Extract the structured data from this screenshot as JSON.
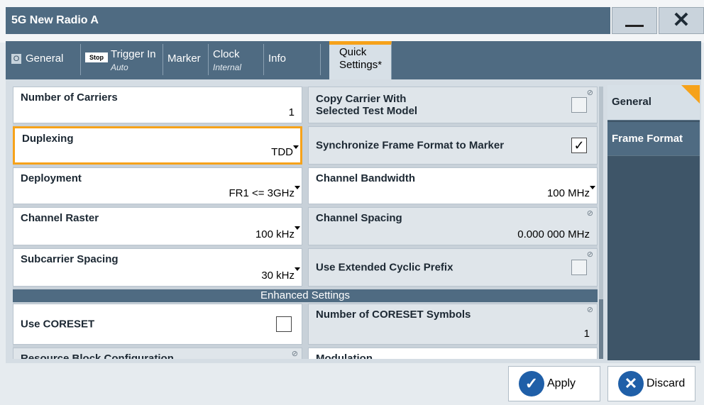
{
  "window": {
    "title": "5G New Radio A"
  },
  "icons": {
    "minimize": "minimize-icon",
    "close": "close-icon",
    "apply": "check-icon",
    "discard": "x-icon",
    "dropdown": "caret-down-icon",
    "lock": "lock-icon"
  },
  "colors": {
    "accent": "#f6a21a",
    "titlebar": "#4f6b82",
    "button_icon": "#1f5fa8"
  },
  "tabs": {
    "general": {
      "badge": "O",
      "label": "General"
    },
    "trigger": {
      "badge": "Stop",
      "label": "Trigger In",
      "sub": "Auto"
    },
    "marker": {
      "label": "Marker"
    },
    "clock": {
      "label": "Clock",
      "sub": "Internal"
    },
    "info": {
      "label": "Info"
    },
    "quick": {
      "label_line1": "Quick",
      "label_line2": "Settings*"
    }
  },
  "fields": {
    "num_carriers": {
      "label": "Number of Carriers",
      "value": "1"
    },
    "copy_carrier": {
      "label_line1": "Copy Carrier With",
      "label_line2": "Selected Test Model",
      "checked": false
    },
    "duplexing": {
      "label": "Duplexing",
      "value": "TDD"
    },
    "sync_frame": {
      "label": "Synchronize Frame Format to Marker",
      "checked": true,
      "check_glyph": "✓"
    },
    "deployment": {
      "label": "Deployment",
      "value": "FR1 <= 3GHz"
    },
    "channel_bw": {
      "label": "Channel Bandwidth",
      "value": "100 MHz"
    },
    "channel_raster": {
      "label": "Channel Raster",
      "value": "100 kHz"
    },
    "channel_spacing": {
      "label": "Channel Spacing",
      "value": "0.000 000 MHz"
    },
    "subcarrier": {
      "label": "Subcarrier Spacing",
      "value": "30 kHz"
    },
    "ext_cp": {
      "label": "Use Extended Cyclic Prefix",
      "checked": false
    },
    "use_coreset": {
      "label": "Use CORESET",
      "checked": false
    },
    "coreset_symbols": {
      "label": "Number of CORESET Symbols",
      "value": "1"
    },
    "rb_config": {
      "label": "Resource Block Configuration"
    },
    "modulation": {
      "label": "Modulation"
    }
  },
  "section": {
    "enhanced": "Enhanced Settings"
  },
  "sidenav": {
    "general": "General",
    "frame_format": "Frame Format"
  },
  "buttons": {
    "apply": "Apply",
    "discard": "Discard"
  }
}
